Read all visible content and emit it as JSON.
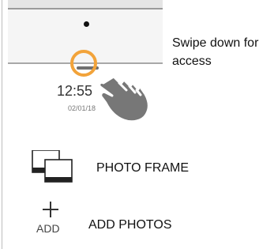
{
  "device": {
    "time": "12:55",
    "date": "02/01/18"
  },
  "hint": {
    "text": "Swipe down for access"
  },
  "features": [
    {
      "label": "PHOTO FRAME",
      "icon": "photo-frame-icon"
    },
    {
      "label": "ADD PHOTOS",
      "icon": "add-photos-icon",
      "icon_caption": "ADD"
    }
  ],
  "colors": {
    "accent": "#f2a33a",
    "text": "#111111",
    "muted": "#777777"
  }
}
